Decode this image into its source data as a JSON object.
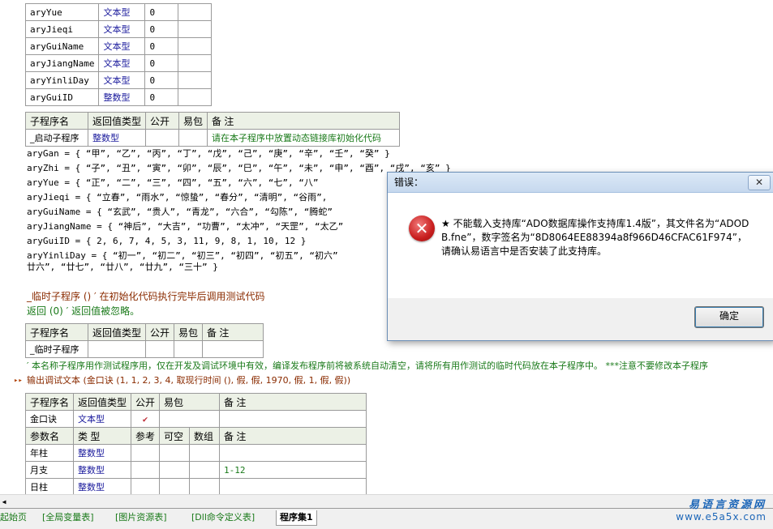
{
  "var_table": [
    {
      "name": "aryYue",
      "type": "文本型",
      "value": "0"
    },
    {
      "name": "aryJieqi",
      "type": "文本型",
      "value": "0"
    },
    {
      "name": "aryGuiName",
      "type": "文本型",
      "value": "0"
    },
    {
      "name": "aryJiangName",
      "type": "文本型",
      "value": "0"
    },
    {
      "name": "aryYinliDay",
      "type": "文本型",
      "value": "0"
    },
    {
      "name": "aryGuiID",
      "type": "整数型",
      "value": "0"
    }
  ],
  "sub1": {
    "headers": [
      "子程序名",
      "返回值类型",
      "公开",
      "易包",
      "备 注"
    ],
    "name": "_启动子程序",
    "ret": "整数型",
    "note": "请在本子程序中放置动态链接库初始化代码"
  },
  "code_lines": [
    "aryGan = { “甲”, “乙”, “丙”, “丁”, “戊”, “己”, “庚”, “辛”, “壬”, “癸” }",
    "aryZhi = { “子”, “丑”, “寅”, “卯”, “辰”, “巳”, “午”, “未”, “申”, “酉”, “戌”, “亥” }",
    "aryYue = { “正”, “二”, “三”, “四”, “五”, “六”, “七”, “八”",
    "aryJieqi = { “立春”, “雨水”, “惊蛰”, “春分”, “清明”, “谷雨”,",
    "aryGuiName = { “玄武”, “贵人”, “青龙”, “六合”, “勾陈”, “腾蛇”",
    "aryJiangName = { “神后”, “大吉”, “功曹”, “太冲”, “天罡”, “太乙”",
    "aryGuiID = { 2, 6, 7, 4, 5, 3, 11, 9, 8, 1, 10, 12 }",
    "aryYinliDay = { “初一”, “初二”, “初三”, “初四”, “初五”, “初六”",
    "廿六”, “廿七”, “廿八”, “廿九”, “三十” }"
  ],
  "temp_section": {
    "line1": "_临时子程序 ()  ′ 在初始化代码执行完毕后调用测试代码",
    "line2": "返回 (0)  ′ 返回值被忽略。",
    "headers": [
      "子程序名",
      "返回值类型",
      "公开",
      "易包",
      "备 注"
    ],
    "name": "_临时子程序",
    "comment": "′ 本名称子程序用作测试程序用，仅在开发及调试环境中有效，编译发布程序前将被系统自动清空，请将所有用作测试的临时代码放在本子程序中。 ***注意不要修改本子程序",
    "debug_line": "输出调试文本 (金口诀 (1, 1, 2, 3, 4, 取现行时间 (), 假, 假, 1970, 假, 1, 假, 假))"
  },
  "sub3": {
    "headers": [
      "子程序名",
      "返回值类型",
      "公开",
      "易包",
      "备 注"
    ],
    "name": "金口诀",
    "ret": "文本型",
    "public_mark": "✔",
    "param_headers": [
      "参数名",
      "类 型",
      "参考",
      "可空",
      "数组",
      "备 注"
    ],
    "params": [
      {
        "name": "年柱",
        "type": "整数型",
        "note": ""
      },
      {
        "name": "月支",
        "type": "整数型",
        "note": "1-12"
      },
      {
        "name": "日柱",
        "type": "整数型",
        "note": ""
      }
    ]
  },
  "dialog": {
    "title": "错误：",
    "close": "✕",
    "message": "★ 不能载入支持库“ADO数据库操作支持库1.4版”，其文件名为“ADODB.fne”，数字签名为“8D8064EE88394a8f966D46CFAC61F974”，请确认易语言中是否安装了此支持库。",
    "ok": "确定"
  },
  "tabs": [
    "起始页",
    "[全局变量表]",
    "[图片资源表]",
    "[Dll命令定义表]",
    "程序集1"
  ],
  "watermark": {
    "line1": "易语言资源网",
    "line2": "www.e5a5x.com"
  },
  "colors": {
    "accent_green": "#1a7a1a",
    "type_blue": "#1a1a9c",
    "header_bg": "#ecf1e6"
  }
}
